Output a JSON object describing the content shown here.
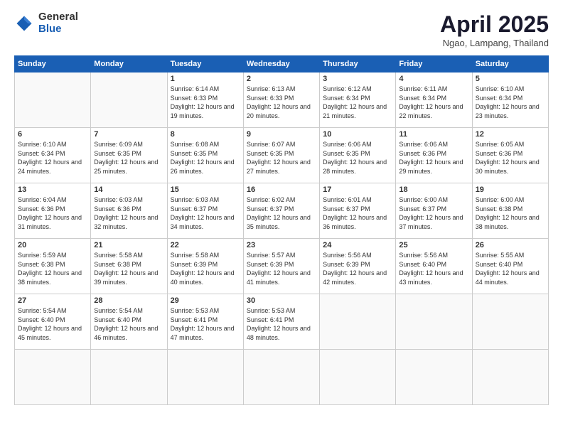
{
  "logo": {
    "general": "General",
    "blue": "Blue"
  },
  "title": "April 2025",
  "location": "Ngao, Lampang, Thailand",
  "weekdays": [
    "Sunday",
    "Monday",
    "Tuesday",
    "Wednesday",
    "Thursday",
    "Friday",
    "Saturday"
  ],
  "days": [
    {
      "num": "",
      "empty": true
    },
    {
      "num": "",
      "empty": true
    },
    {
      "num": "1",
      "sunrise": "6:14 AM",
      "sunset": "6:33 PM",
      "daylight": "12 hours and 19 minutes."
    },
    {
      "num": "2",
      "sunrise": "6:13 AM",
      "sunset": "6:33 PM",
      "daylight": "12 hours and 20 minutes."
    },
    {
      "num": "3",
      "sunrise": "6:12 AM",
      "sunset": "6:34 PM",
      "daylight": "12 hours and 21 minutes."
    },
    {
      "num": "4",
      "sunrise": "6:11 AM",
      "sunset": "6:34 PM",
      "daylight": "12 hours and 22 minutes."
    },
    {
      "num": "5",
      "sunrise": "6:10 AM",
      "sunset": "6:34 PM",
      "daylight": "12 hours and 23 minutes."
    },
    {
      "num": "6",
      "sunrise": "6:10 AM",
      "sunset": "6:34 PM",
      "daylight": "12 hours and 24 minutes."
    },
    {
      "num": "7",
      "sunrise": "6:09 AM",
      "sunset": "6:35 PM",
      "daylight": "12 hours and 25 minutes."
    },
    {
      "num": "8",
      "sunrise": "6:08 AM",
      "sunset": "6:35 PM",
      "daylight": "12 hours and 26 minutes."
    },
    {
      "num": "9",
      "sunrise": "6:07 AM",
      "sunset": "6:35 PM",
      "daylight": "12 hours and 27 minutes."
    },
    {
      "num": "10",
      "sunrise": "6:06 AM",
      "sunset": "6:35 PM",
      "daylight": "12 hours and 28 minutes."
    },
    {
      "num": "11",
      "sunrise": "6:06 AM",
      "sunset": "6:36 PM",
      "daylight": "12 hours and 29 minutes."
    },
    {
      "num": "12",
      "sunrise": "6:05 AM",
      "sunset": "6:36 PM",
      "daylight": "12 hours and 30 minutes."
    },
    {
      "num": "13",
      "sunrise": "6:04 AM",
      "sunset": "6:36 PM",
      "daylight": "12 hours and 31 minutes."
    },
    {
      "num": "14",
      "sunrise": "6:03 AM",
      "sunset": "6:36 PM",
      "daylight": "12 hours and 32 minutes."
    },
    {
      "num": "15",
      "sunrise": "6:03 AM",
      "sunset": "6:37 PM",
      "daylight": "12 hours and 34 minutes."
    },
    {
      "num": "16",
      "sunrise": "6:02 AM",
      "sunset": "6:37 PM",
      "daylight": "12 hours and 35 minutes."
    },
    {
      "num": "17",
      "sunrise": "6:01 AM",
      "sunset": "6:37 PM",
      "daylight": "12 hours and 36 minutes."
    },
    {
      "num": "18",
      "sunrise": "6:00 AM",
      "sunset": "6:37 PM",
      "daylight": "12 hours and 37 minutes."
    },
    {
      "num": "19",
      "sunrise": "6:00 AM",
      "sunset": "6:38 PM",
      "daylight": "12 hours and 38 minutes."
    },
    {
      "num": "20",
      "sunrise": "5:59 AM",
      "sunset": "6:38 PM",
      "daylight": "12 hours and 38 minutes."
    },
    {
      "num": "21",
      "sunrise": "5:58 AM",
      "sunset": "6:38 PM",
      "daylight": "12 hours and 39 minutes."
    },
    {
      "num": "22",
      "sunrise": "5:58 AM",
      "sunset": "6:39 PM",
      "daylight": "12 hours and 40 minutes."
    },
    {
      "num": "23",
      "sunrise": "5:57 AM",
      "sunset": "6:39 PM",
      "daylight": "12 hours and 41 minutes."
    },
    {
      "num": "24",
      "sunrise": "5:56 AM",
      "sunset": "6:39 PM",
      "daylight": "12 hours and 42 minutes."
    },
    {
      "num": "25",
      "sunrise": "5:56 AM",
      "sunset": "6:40 PM",
      "daylight": "12 hours and 43 minutes."
    },
    {
      "num": "26",
      "sunrise": "5:55 AM",
      "sunset": "6:40 PM",
      "daylight": "12 hours and 44 minutes."
    },
    {
      "num": "27",
      "sunrise": "5:54 AM",
      "sunset": "6:40 PM",
      "daylight": "12 hours and 45 minutes."
    },
    {
      "num": "28",
      "sunrise": "5:54 AM",
      "sunset": "6:40 PM",
      "daylight": "12 hours and 46 minutes."
    },
    {
      "num": "29",
      "sunrise": "5:53 AM",
      "sunset": "6:41 PM",
      "daylight": "12 hours and 47 minutes."
    },
    {
      "num": "30",
      "sunrise": "5:53 AM",
      "sunset": "6:41 PM",
      "daylight": "12 hours and 48 minutes."
    },
    {
      "num": "",
      "empty": true
    },
    {
      "num": "",
      "empty": true
    },
    {
      "num": "",
      "empty": true
    },
    {
      "num": "",
      "empty": true
    },
    {
      "num": "",
      "empty": true
    }
  ]
}
